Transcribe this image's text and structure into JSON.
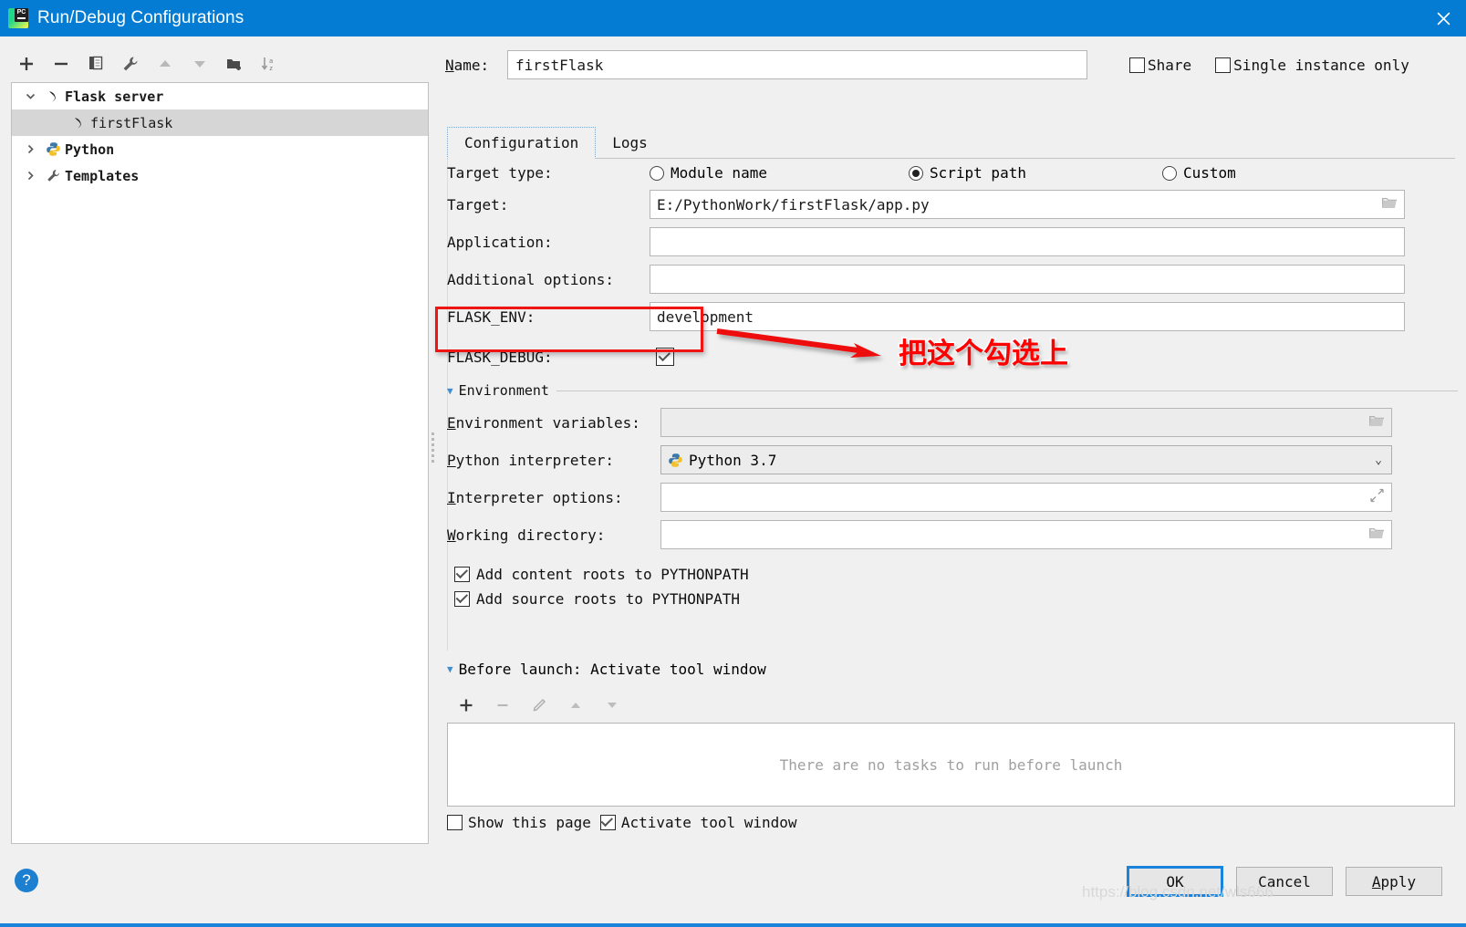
{
  "window": {
    "title": "Run/Debug Configurations",
    "app_icon": "pycharm-icon",
    "close_icon": "close-icon",
    "titlebar_color": "#047cd4"
  },
  "tree_toolbar": {
    "buttons": [
      {
        "name": "add-configuration-button",
        "icon": "plus-icon"
      },
      {
        "name": "remove-configuration-button",
        "icon": "minus-icon"
      },
      {
        "name": "copy-configuration-button",
        "icon": "copy-icon"
      },
      {
        "name": "edit-templates-button",
        "icon": "wrench-icon"
      },
      {
        "name": "move-up-button",
        "icon": "arrow-up-icon"
      },
      {
        "name": "move-down-button",
        "icon": "arrow-down-icon"
      },
      {
        "name": "create-folder-button",
        "icon": "folder-add-icon"
      },
      {
        "name": "sort-configurations-button",
        "icon": "sort-az-icon"
      }
    ]
  },
  "tree": {
    "items": [
      {
        "label": "Flask server",
        "icon": "flask-icon",
        "expanded": true,
        "level": 0,
        "selected": false,
        "has_twisty": true
      },
      {
        "label": "firstFlask",
        "icon": "flask-icon",
        "expanded": false,
        "level": 1,
        "selected": true,
        "has_twisty": false
      },
      {
        "label": "Python",
        "icon": "python-icon",
        "expanded": false,
        "level": 0,
        "selected": false,
        "has_twisty": true
      },
      {
        "label": "Templates",
        "icon": "wrench-icon",
        "expanded": false,
        "level": 0,
        "selected": false,
        "has_twisty": true
      }
    ]
  },
  "header": {
    "name_label": "Name:",
    "name_value": "firstFlask",
    "share_label": "Share",
    "share_checked": false,
    "single_instance_label": "Single instance only",
    "single_instance_checked": false
  },
  "tabs": [
    {
      "label": "Configuration",
      "active": true
    },
    {
      "label": "Logs",
      "active": false
    }
  ],
  "config": {
    "target_type_label": "Target type:",
    "target_type_options": [
      {
        "label": "Module name",
        "selected": false
      },
      {
        "label": "Script path",
        "selected": true
      },
      {
        "label": "Custom",
        "selected": false
      }
    ],
    "target_label": "Target:",
    "target_value": "E:/PythonWork/firstFlask/app.py",
    "application_label": "Application:",
    "application_value": "",
    "additional_options_label": "Additional options:",
    "additional_options_value": "",
    "flask_env_label": "FLASK_ENV:",
    "flask_env_value": "development",
    "flask_debug_label": "FLASK_DEBUG:",
    "flask_debug_checked": true
  },
  "environment": {
    "section_title": "Environment",
    "env_vars_label": "Environment variables:",
    "env_vars_value": "",
    "interpreter_label": "Python interpreter:",
    "interpreter_value": "Python 3.7",
    "interpreter_icon": "python-icon",
    "interpreter_options_label": "Interpreter options:",
    "interpreter_options_value": "",
    "working_dir_label": "Working directory:",
    "working_dir_value": "",
    "add_content_roots_label": "Add content roots to PYTHONPATH",
    "add_content_roots_checked": true,
    "add_source_roots_label": "Add source roots to PYTHONPATH",
    "add_source_roots_checked": true
  },
  "before_launch": {
    "section_title": "Before launch: Activate tool window",
    "toolbar": [
      {
        "name": "add-task-button",
        "icon": "plus-icon"
      },
      {
        "name": "remove-task-button",
        "icon": "minus-icon"
      },
      {
        "name": "edit-task-button",
        "icon": "pencil-icon"
      },
      {
        "name": "task-move-up-button",
        "icon": "arrow-up-icon"
      },
      {
        "name": "task-move-down-button",
        "icon": "arrow-down-icon"
      }
    ],
    "empty_text": "There are no tasks to run before launch",
    "show_page_label": "Show this page",
    "show_page_checked": false,
    "activate_tool_window_label": "Activate tool window",
    "activate_tool_window_checked": true
  },
  "footer": {
    "help_label": "?",
    "ok_label": "OK",
    "cancel_label": "Cancel",
    "apply_label": "Apply"
  },
  "annotation": {
    "text": "把这个勾选上",
    "color": "#ff0000"
  },
  "watermark": {
    "text": "https://blog.csdn.net/wls666"
  }
}
